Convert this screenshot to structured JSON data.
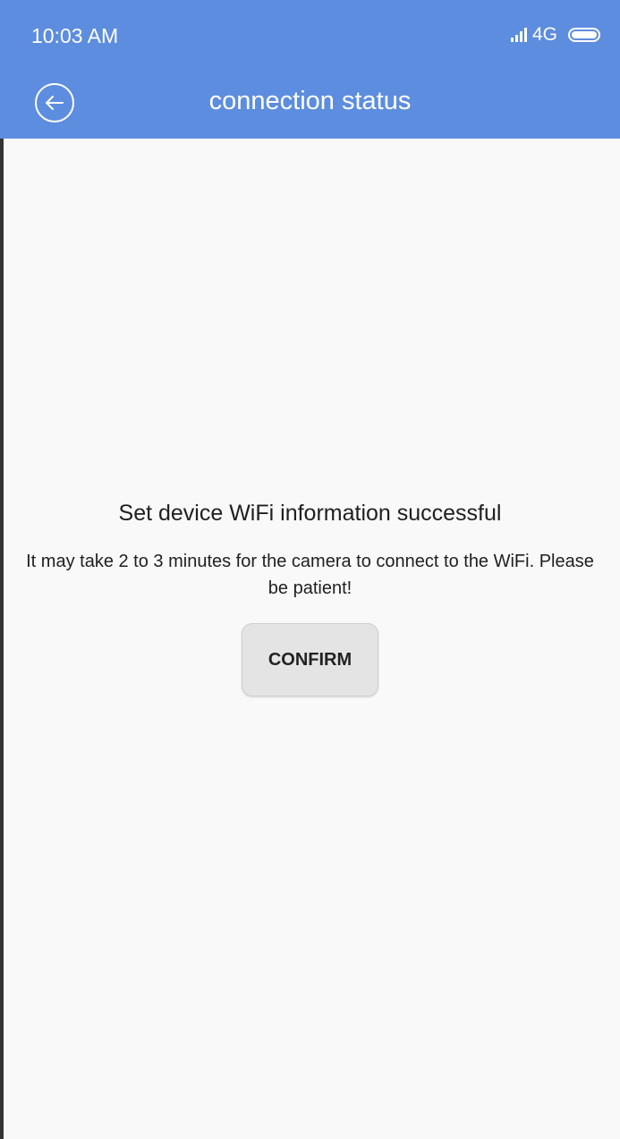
{
  "status_bar": {
    "time": "10:03 AM",
    "network": "4G",
    "signal_icon": "signal-icon",
    "battery_icon": "battery-icon"
  },
  "header": {
    "title": "connection status",
    "back_icon": "back-arrow-icon",
    "background": "#5d8ddf"
  },
  "main": {
    "headline": "Set device WiFi information successful",
    "message": "It may take 2 to 3 minutes for the camera to connect to the WiFi. Please be patient!",
    "confirm_label": "CONFIRM"
  }
}
